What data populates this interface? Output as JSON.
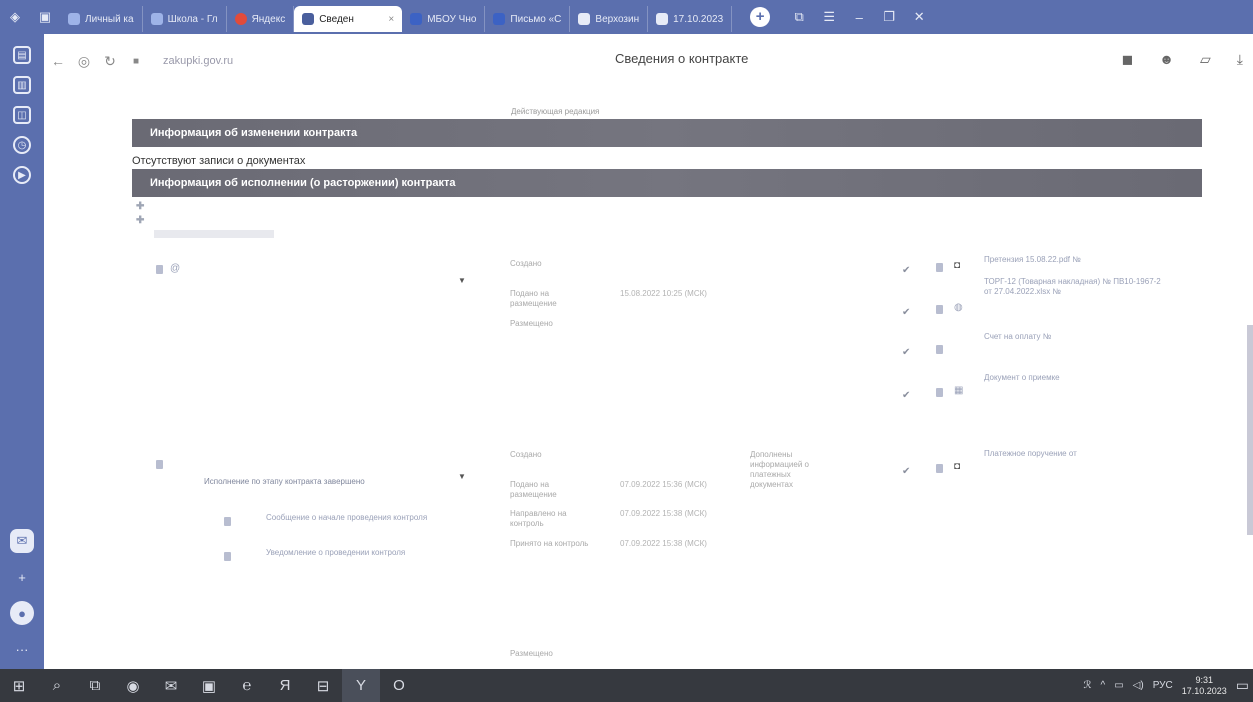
{
  "tabs": [
    {
      "label": "Личный ка",
      "icon": "vk-icon",
      "color": "#9eb3e8"
    },
    {
      "label": "Школа - Гл",
      "icon": "vk-icon",
      "color": "#9eb3e8"
    },
    {
      "label": "Яндекс",
      "icon": "yandex-icon",
      "color": "#e24b3a"
    },
    {
      "label": "Сведен",
      "icon": "emblem-icon",
      "color": "#4a5f9d",
      "active": true
    },
    {
      "label": "МБОУ Чно",
      "icon": "mail-icon",
      "color": "#3c62c4"
    },
    {
      "label": "Письмо «С",
      "icon": "mail-icon",
      "color": "#3c62c4"
    },
    {
      "label": "Верхозин",
      "icon": "doc-icon",
      "color": "#fff"
    },
    {
      "label": "17.10.2023",
      "icon": "doc-icon",
      "color": "#fff"
    }
  ],
  "address": {
    "url": "zakupki.gov.ru",
    "page_title": "Сведения о контракте"
  },
  "edition": "Действующая редакция",
  "sections": {
    "changes": "Информация об изменении контракта",
    "no_entries": "Отсутствуют записи о документах",
    "execution": "Информация об исполнении (о расторжении) контракта"
  },
  "actions": {
    "create1": "",
    "create2": "",
    "right_link": ""
  },
  "record1": {
    "title": "",
    "number": "",
    "check": "",
    "fields": [
      {
        "label": "Создано",
        "value": ""
      },
      {
        "label": "Подано на размещение",
        "value": "15.08.2022 10:25 (МСК)"
      },
      {
        "label": "Размещено",
        "value": ""
      },
      {
        "label": "",
        "value": ""
      }
    ],
    "docs": [
      "Претензия 15.08.22.pdf №",
      "ТОРГ-12 (Товарная накладная) № ПВ10-1967-2 от 27.04.2022.xlsx №",
      "Счет на оплату №",
      "Документ о приемке"
    ]
  },
  "record2": {
    "title": "",
    "number": "",
    "status": "Исполнение по этапу контракта завершено",
    "subitems": [
      "Сообщение о начале проведения контроля",
      "Уведомление о проведении контроля"
    ],
    "fields": [
      {
        "label": "Создано",
        "value": ""
      },
      {
        "label": "Подано на размещение",
        "value": "07.09.2022 15:36 (МСК)"
      },
      {
        "label": "Направлено на контроль",
        "value": "07.09.2022 15:38 (МСК)"
      },
      {
        "label": "Принято на контроль",
        "value": "07.09.2022 15:38 (МСК)"
      },
      {
        "label": "",
        "value": ""
      },
      {
        "label": "Размещено",
        "value": ""
      }
    ],
    "extra": "Дополнены информацией о платежных документах",
    "doc": "Платежное поручение от"
  },
  "taskbar": {
    "lang": "РУС",
    "time": "9:31",
    "date": "17.10.2023"
  }
}
